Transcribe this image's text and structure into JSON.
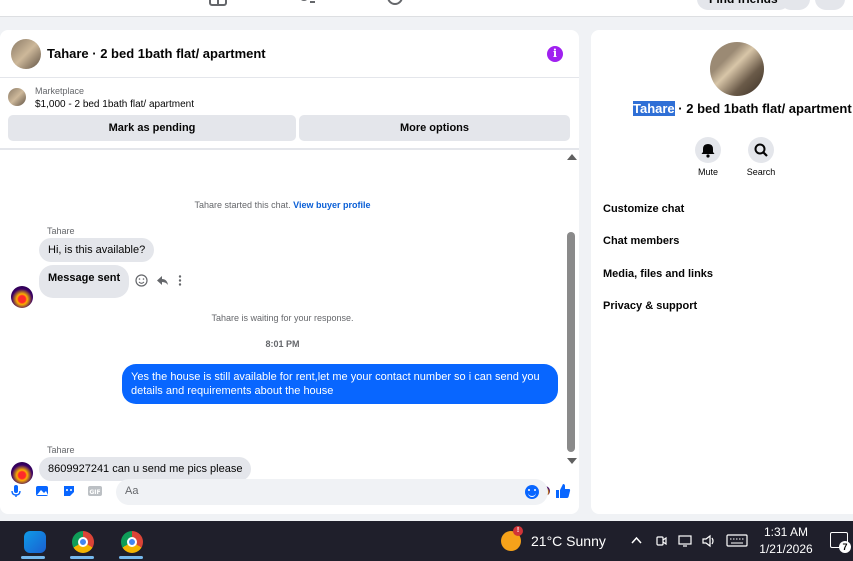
{
  "topbar": {
    "find_friends": "Find friends"
  },
  "chat": {
    "header_title": "Tahare · 2 bed 1bath flat/ apartment",
    "info_glyph": "i",
    "marketplace_label": "Marketplace",
    "listing": "$1,000 - 2 bed 1bath flat/ apartment",
    "mark_pending": "Mark as pending",
    "more_options": "More options",
    "started_text": "Tahare started this chat.",
    "view_buyer_profile": "View buyer profile",
    "sender_1": "Tahare",
    "msg_1": "Hi, is this available?",
    "msg_2": "Message sent",
    "waiting_text": "Tahare is waiting for your response.",
    "time_divider": "8:01 PM",
    "outgoing": "Yes the house is still available for rent,let me your contact number so i can send you details and requirements about the house",
    "sender_2": "Tahare",
    "msg_3": "8609927241 can u send me pics please",
    "composer_placeholder": "Aa"
  },
  "details": {
    "title_highlight": "Tahare",
    "title_rest": " · 2 bed 1bath flat/ apartment",
    "mute": "Mute",
    "search": "Search",
    "menu": [
      "Customize chat",
      "Chat members",
      "Media, files and links",
      "Privacy & support"
    ]
  },
  "taskbar": {
    "weather_badge": "!",
    "weather": "21°C  Sunny",
    "time": "1:31 AM",
    "date": "1/21/2026",
    "notifications": "7"
  },
  "colors": {
    "accent": "#0866ff",
    "highlight": "#2f6fd6",
    "info": "#a020f0"
  }
}
